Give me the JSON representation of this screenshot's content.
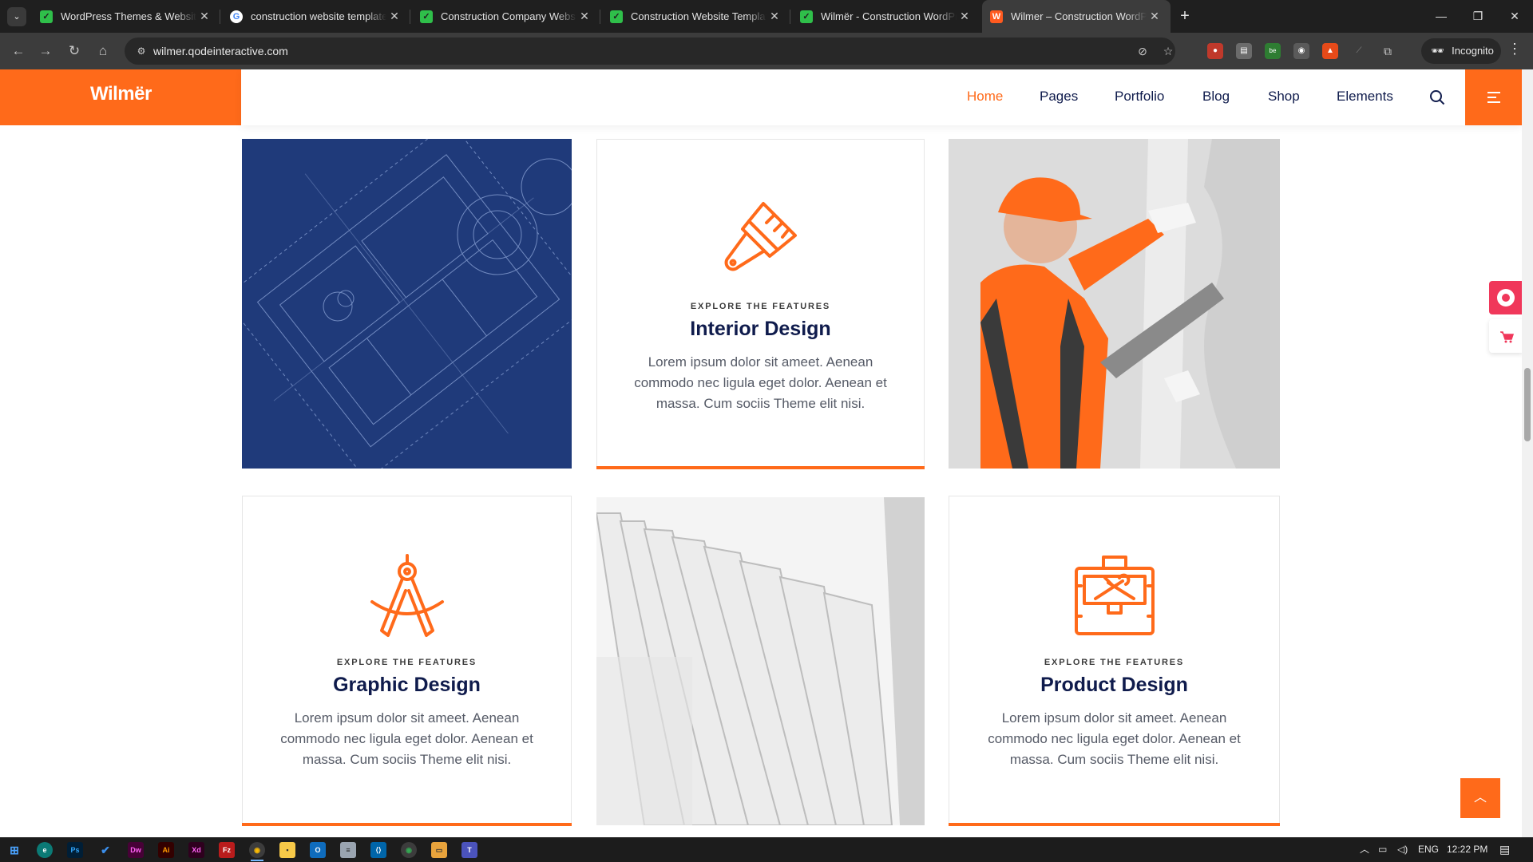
{
  "browser": {
    "tabs": [
      {
        "title": "WordPress Themes & Website Templates",
        "favicon": "envato-icon",
        "active": false
      },
      {
        "title": "construction website template - Google Search",
        "favicon": "google-icon",
        "active": false
      },
      {
        "title": "Construction Company Website Templates",
        "favicon": "envato-icon",
        "active": false
      },
      {
        "title": "Construction Website Templates",
        "favicon": "envato-icon",
        "active": false
      },
      {
        "title": "Wilmër - Construction WordPress Theme",
        "favicon": "envato-icon",
        "active": false
      },
      {
        "title": "Wilmer – Construction WordPress Theme",
        "favicon": "wilmer-icon",
        "active": true
      }
    ],
    "url": "wilmer.qodeinteractive.com",
    "incognito_label": "Incognito"
  },
  "site": {
    "logo": "Wilmër",
    "nav": [
      {
        "label": "Home",
        "active": true
      },
      {
        "label": "Pages",
        "active": false
      },
      {
        "label": "Portfolio",
        "active": false
      },
      {
        "label": "Blog",
        "active": false
      },
      {
        "label": "Shop",
        "active": false
      },
      {
        "label": "Elements",
        "active": false
      }
    ],
    "accent_color": "#ff6a1a",
    "title_color": "#0f1b4c"
  },
  "cards": [
    {
      "eyebrow": "EXPLORE THE FEATURES",
      "title": "Interior Design",
      "text": "Lorem ipsum dolor sit ameet. Aenean commodo nec ligula eget dolor. Aenean et massa. Cum sociis Theme elit nisi.",
      "icon": "paint-brush-icon"
    },
    {
      "eyebrow": "EXPLORE THE FEATURES",
      "title": "Graphic Design",
      "text": "Lorem ipsum dolor sit ameet. Aenean commodo nec ligula eget dolor. Aenean et massa. Cum sociis Theme elit nisi.",
      "icon": "drafting-compass-icon"
    },
    {
      "eyebrow": "EXPLORE THE FEATURES",
      "title": "Product Design",
      "text": "Lorem ipsum dolor sit ameet. Aenean commodo nec ligula eget dolor. Aenean et massa. Cum sociis Theme elit nisi.",
      "icon": "toolbox-icon"
    }
  ],
  "taskbar": {
    "language": "ENG",
    "time": "12:22 PM"
  }
}
